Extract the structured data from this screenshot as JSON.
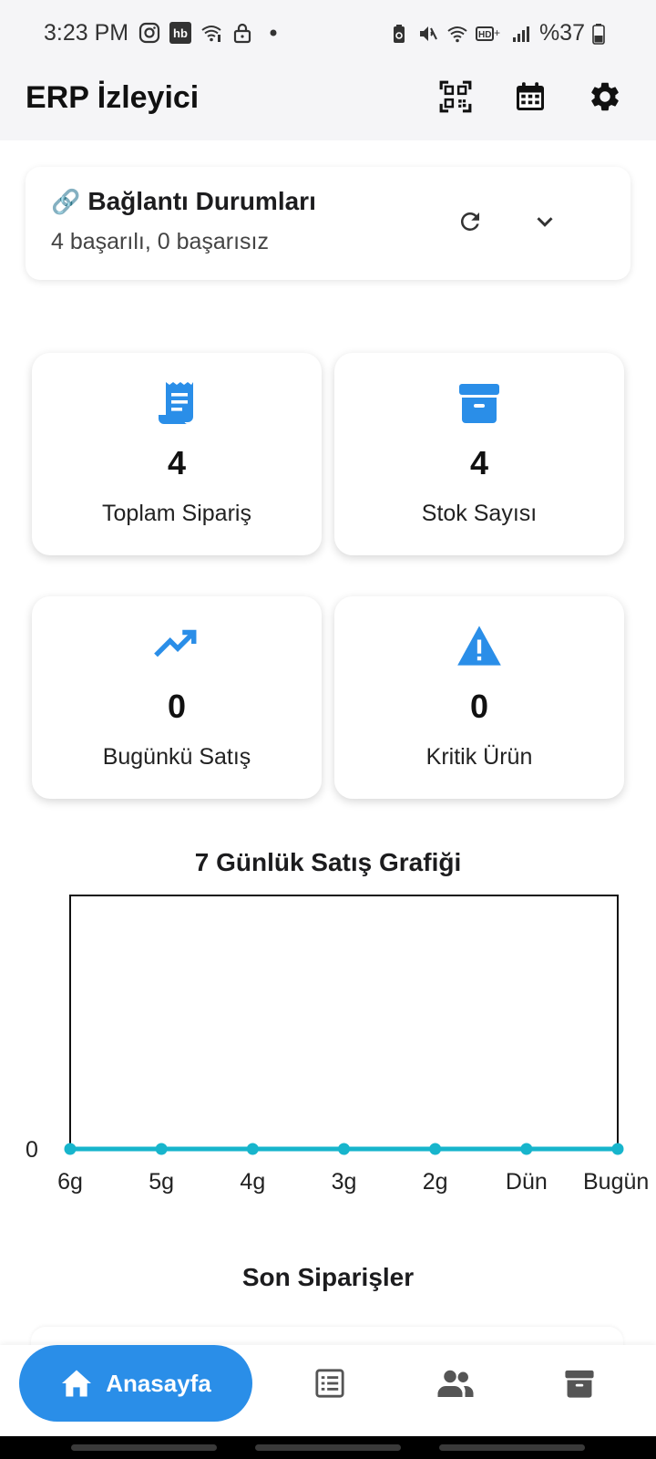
{
  "status_bar": {
    "time": "3:23 PM",
    "battery": "%37",
    "left_icons": [
      "instagram-icon",
      "hb-app-icon",
      "wifi-call-icon",
      "lock-icon",
      "dot-icon"
    ],
    "right_icons": [
      "battery-saver-icon",
      "mute-icon",
      "wifi-icon",
      "hd-plus-icon",
      "signal-icon",
      "battery-icon"
    ],
    "hb_text": "hb"
  },
  "app_bar": {
    "title": "ERP İzleyici",
    "actions": [
      "qr-code-icon",
      "calendar-icon",
      "settings-icon"
    ]
  },
  "connection": {
    "emoji": "🔗",
    "title": "Bağlantı Durumları",
    "subtitle": "4 başarılı, 0 başarısız",
    "actions": [
      "refresh-icon",
      "chevron-down-icon"
    ]
  },
  "stats": [
    {
      "icon": "receipt-icon",
      "value": "4",
      "label": "Toplam Sipariş"
    },
    {
      "icon": "inventory-icon",
      "value": "4",
      "label": "Stok Sayısı"
    },
    {
      "icon": "trending-up-icon",
      "value": "0",
      "label": "Bugünkü Satış"
    },
    {
      "icon": "warning-icon",
      "value": "0",
      "label": "Kritik Ürün"
    }
  ],
  "colors": {
    "accent": "#2a8ee8",
    "chart_line": "#17b5cc",
    "appbar_bg": "#f5f5f7"
  },
  "chart_data": {
    "type": "line",
    "title": "7 Günlük Satış Grafiği",
    "categories": [
      "6g",
      "5g",
      "4g",
      "3g",
      "2g",
      "Dün",
      "Bugün"
    ],
    "series": [
      {
        "values": [
          0,
          0,
          0,
          0,
          0,
          0,
          0
        ]
      }
    ],
    "y_tick_labels": [
      "0"
    ],
    "xlabel": "",
    "ylabel": "",
    "grid": false,
    "legend": "none"
  },
  "recent": {
    "title": "Son Siparişler"
  },
  "bottom_nav": {
    "home_label": "Anasayfa",
    "items": [
      "home-icon",
      "list-icon",
      "people-icon",
      "archive-icon"
    ]
  }
}
